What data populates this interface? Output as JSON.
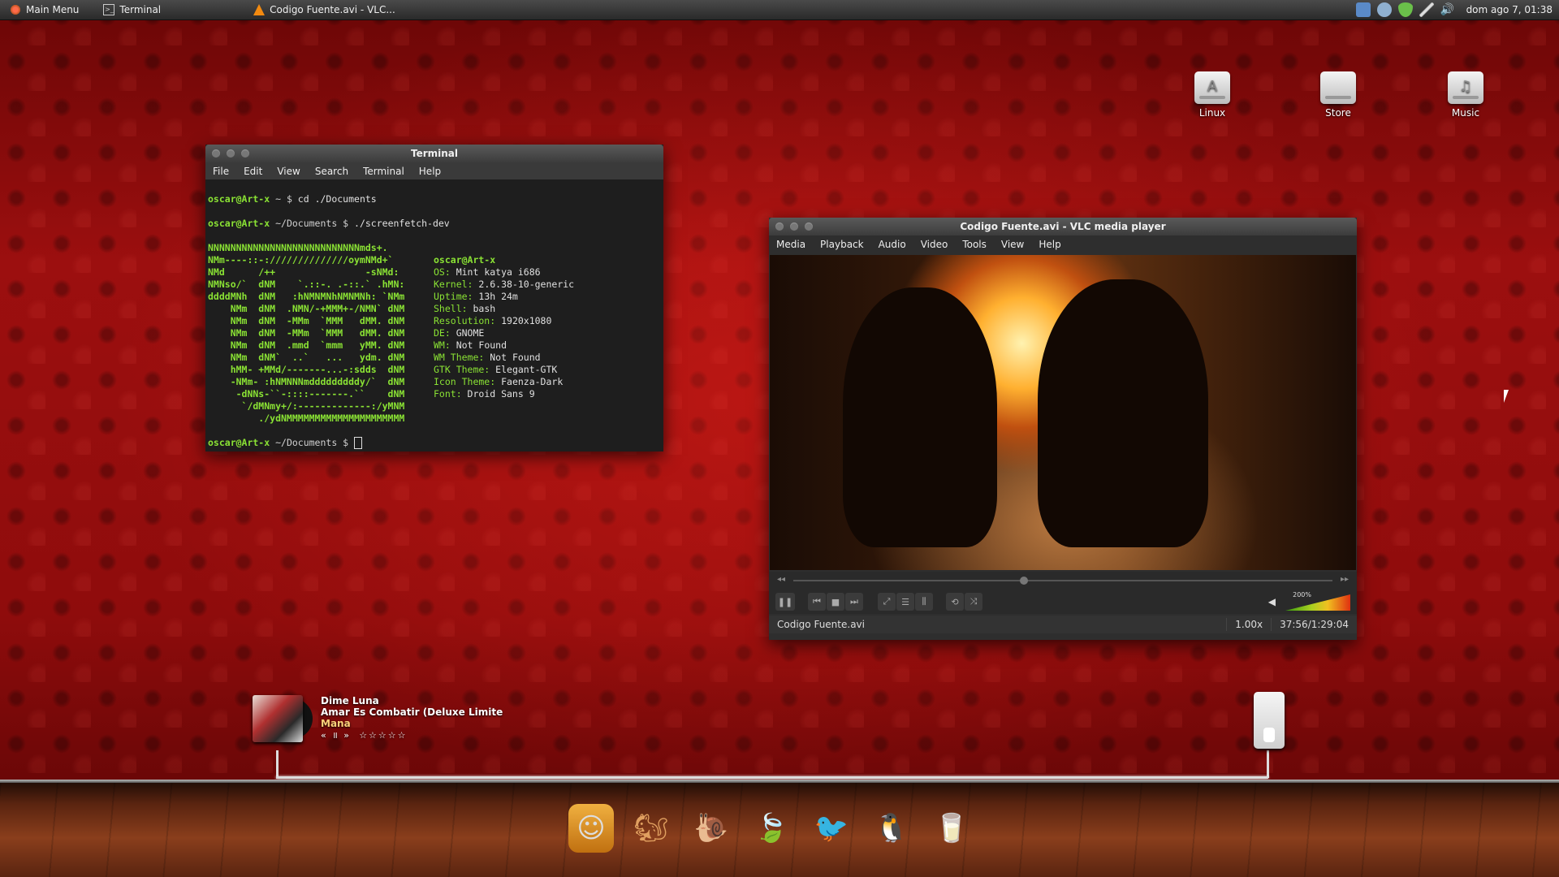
{
  "top_panel": {
    "main_menu": "Main Menu",
    "tasks": [
      "Terminal",
      "Codigo Fuente.avi - VLC..."
    ],
    "clock": "dom ago  7, 01:38"
  },
  "desktop_icons": [
    {
      "label": "Linux",
      "icon": "drive-icon"
    },
    {
      "label": "Store",
      "icon": "drive-icon"
    },
    {
      "label": "Music",
      "icon": "music-drive-icon"
    }
  ],
  "terminal": {
    "title": "Terminal",
    "menu": [
      "File",
      "Edit",
      "View",
      "Search",
      "Terminal",
      "Help"
    ],
    "lines": [
      {
        "user": "oscar@Art-x",
        "path": " ~ $ ",
        "cmd": "cd ./Documents"
      },
      {
        "user": "oscar@Art-x",
        "path": " ~/Documents $ ",
        "cmd": "./screenfetch-dev"
      }
    ],
    "logo": [
      "NNNNNNNNNNNNNNNNNNNNNNNNNNNmds+.",
      "NMm----::-://////////////oymNMd+`",
      "NMd      /++                -sNMd:",
      "NMNso/`  dNM    `.::-. .-::.` .hMN:",
      "ddddMNh  dNM   :hNMNMNhNMNMNh: `NMm",
      "    NMm  dNM  .NMN/-+MMM+-/NMN` dNM",
      "    NMm  dNM  -MMm  `MMM   dMM. dNM",
      "    NMm  dNM  -MMm  `MMM   dMM. dNM",
      "    NMm  dNM  .mmd  `mmm   yMM. dNM",
      "    NMm  dNM`  ..`   ...   ydm. dNM",
      "    hMM- +MMd/-------...-:sdds  dNM",
      "    -NMm- :hNMNNNmdddddddddy/`  dNM",
      "     -dNNs-``-::::-------.``    dNM",
      "      `/dMNmy+/:-------------:/yMNM",
      "         ./ydNMMMMMMMMMMMMMMMMMMMMM"
    ],
    "info_header": "oscar@Art-x",
    "info": [
      {
        "k": "OS:",
        "v": "Mint katya i686"
      },
      {
        "k": "Kernel:",
        "v": "2.6.38-10-generic"
      },
      {
        "k": "Uptime:",
        "v": "13h 24m"
      },
      {
        "k": "Shell:",
        "v": "bash"
      },
      {
        "k": "Resolution:",
        "v": "1920x1080"
      },
      {
        "k": "DE:",
        "v": "GNOME"
      },
      {
        "k": "WM:",
        "v": "Not Found"
      },
      {
        "k": "WM Theme:",
        "v": "Not Found"
      },
      {
        "k": "GTK Theme:",
        "v": "Elegant-GTK"
      },
      {
        "k": "Icon Theme:",
        "v": "Faenza-Dark"
      },
      {
        "k": "Font:",
        "v": "Droid Sans 9"
      }
    ],
    "final_prompt": {
      "user": "oscar@Art-x",
      "path": " ~/Documents $ "
    }
  },
  "vlc": {
    "title": "Codigo Fuente.avi - VLC media player",
    "menu": [
      "Media",
      "Playback",
      "Audio",
      "Video",
      "Tools",
      "View",
      "Help"
    ],
    "seek_position": 0.42,
    "volume_label": "200%",
    "status_file": "Codigo Fuente.avi",
    "speed": "1.00x",
    "time": "37:56/1:29:04"
  },
  "music_widget": {
    "title": "Dime Luna",
    "album": "Amar Es Combatir (Deluxe Limite",
    "artist": "Mana",
    "controls": "« ॥ »",
    "rating": "☆☆☆☆☆"
  },
  "dock": [
    "store-icon",
    "squirrel-icon",
    "snail-icon",
    "leaf-icon",
    "bird-icon",
    "penguin-icon",
    "milk-icon"
  ]
}
